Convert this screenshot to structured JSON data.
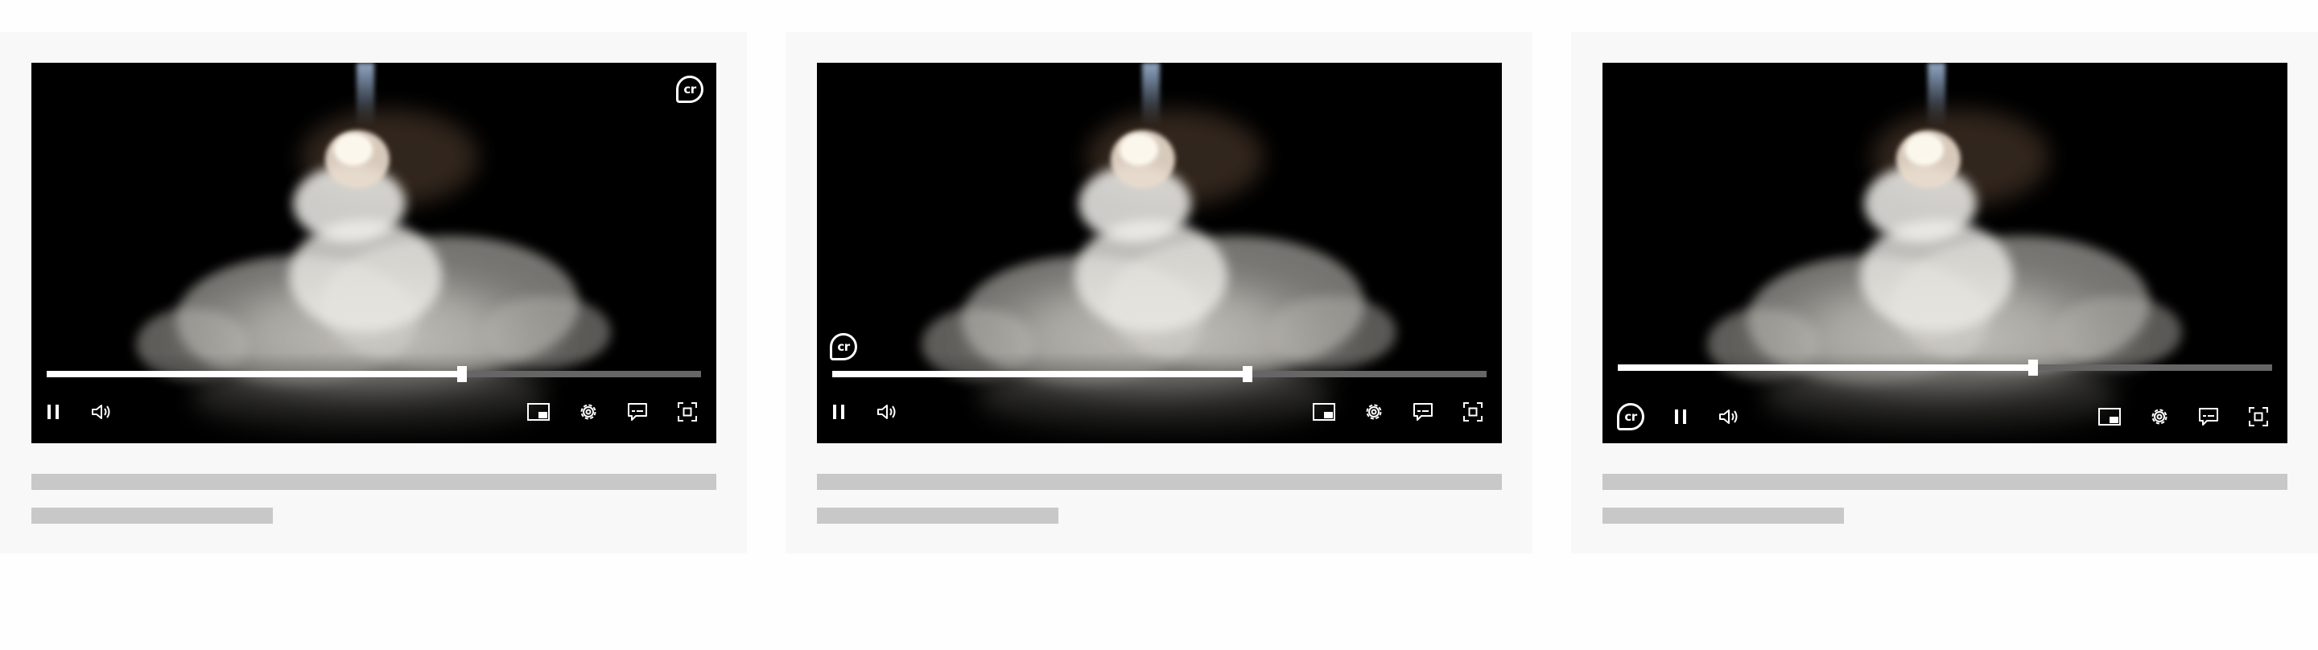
{
  "cards": [
    {
      "variant": "badge top-right",
      "progress": {
        "played_fraction": 0.635
      },
      "badge": {
        "text": "cr",
        "icon": "content-credentials-icon"
      }
    },
    {
      "variant": "badge above controls, left",
      "progress": {
        "played_fraction": 0.635
      },
      "badge": {
        "text": "cr",
        "icon": "content-credentials-icon"
      }
    },
    {
      "variant": "badge inline in control bar",
      "progress": {
        "played_fraction": 0.635
      },
      "badge": {
        "text": "cr",
        "icon": "content-credentials-icon"
      }
    }
  ],
  "controls": {
    "left": [
      "pause-icon",
      "volume-icon"
    ],
    "right": [
      "picture-in-picture-icon",
      "settings-gear-icon",
      "captions-icon",
      "fullscreen-icon"
    ]
  },
  "colors": {
    "page_background": "#fefefe",
    "card_background": "#f8f8f8",
    "video_background": "#000000",
    "progress_played": "#ffffff",
    "progress_unplayed": "#666666",
    "placeholder_line": "#c8c8c8"
  }
}
